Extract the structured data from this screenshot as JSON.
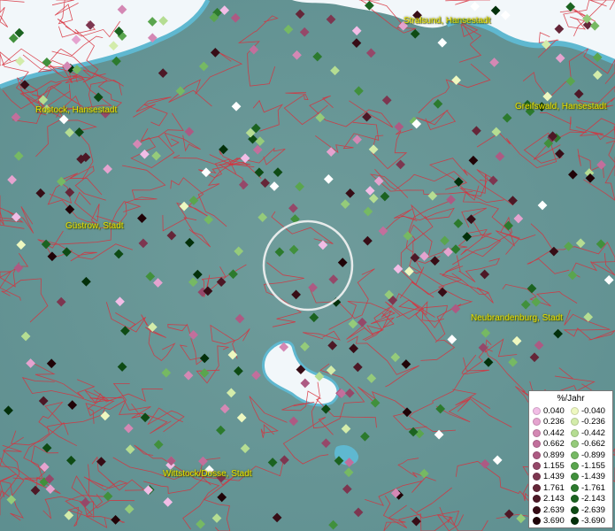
{
  "map": {
    "colors": {
      "land": "#6a9a9a",
      "water": "#f2f7fa",
      "shallow": "#5fb8d0",
      "borders": "#d8303c"
    },
    "cities": [
      {
        "id": "stralsund",
        "label": "Stralsund, Hansestadt"
      },
      {
        "id": "rostock",
        "label": "Rostock, Hansestadt"
      },
      {
        "id": "greifswald",
        "label": "Greifswald, Hansestadt"
      },
      {
        "id": "guestrow",
        "label": "Güstrow, Stadt"
      },
      {
        "id": "neubrandenburg",
        "label": "Neubrandenburg, Stadt"
      },
      {
        "id": "wittstock",
        "label": "Wittstock/Dosse, Stadt"
      }
    ]
  },
  "legend": {
    "title": "%/Jahr",
    "positive": [
      {
        "label": "0.040",
        "color": "#f2bde6"
      },
      {
        "label": "0.236",
        "color": "#e5a3cf"
      },
      {
        "label": "0.442",
        "color": "#d488b4"
      },
      {
        "label": "0.662",
        "color": "#c26f9c"
      },
      {
        "label": "0.899",
        "color": "#ad5a83"
      },
      {
        "label": "1.155",
        "color": "#954869"
      },
      {
        "label": "1.439",
        "color": "#7d3650"
      },
      {
        "label": "1.761",
        "color": "#652638"
      },
      {
        "label": "2.143",
        "color": "#4d1826"
      },
      {
        "label": "2.639",
        "color": "#370d16"
      },
      {
        "label": "3.690",
        "color": "#200307"
      }
    ],
    "negative": [
      {
        "label": "-0.040",
        "color": "#eef8c0"
      },
      {
        "label": "-0.236",
        "color": "#d3ecaa"
      },
      {
        "label": "-0.442",
        "color": "#b5dd92"
      },
      {
        "label": "-0.662",
        "color": "#95cb7a"
      },
      {
        "label": "-0.899",
        "color": "#76b963"
      },
      {
        "label": "-1.155",
        "color": "#5aa54e"
      },
      {
        "label": "-1.439",
        "color": "#41903c"
      },
      {
        "label": "-1.761",
        "color": "#2c7a2d"
      },
      {
        "label": "-2.143",
        "color": "#1b6320"
      },
      {
        "label": "-2.639",
        "color": "#0e4b14"
      },
      {
        "label": "-3.690",
        "color": "#03300a"
      }
    ]
  }
}
